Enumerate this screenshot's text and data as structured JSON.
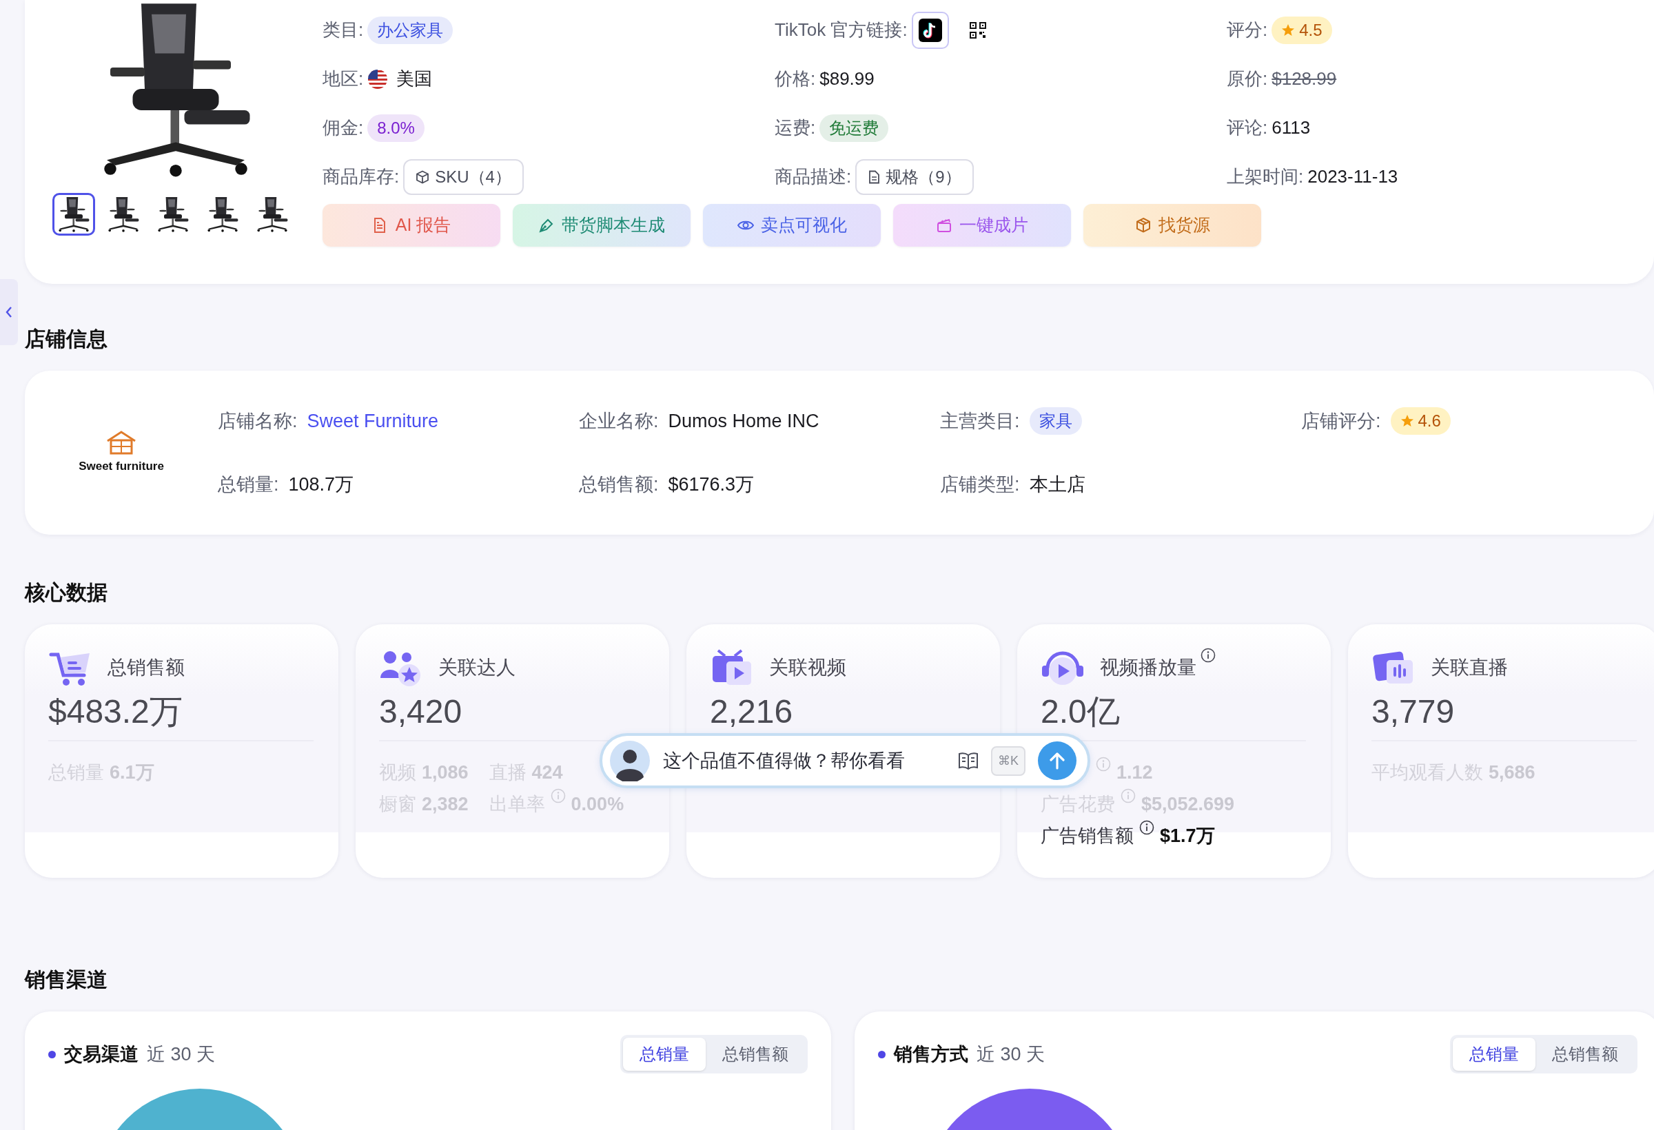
{
  "product": {
    "thumbnails": [
      {
        "selected": true
      },
      {
        "selected": false
      },
      {
        "selected": false
      },
      {
        "selected": false
      },
      {
        "selected": false
      }
    ],
    "fields": [
      {
        "kind": "tag",
        "label": "类目:",
        "value": "办公家具",
        "color": "#3b4fe0"
      },
      {
        "kind": "links",
        "label": "TikTok 官方链接:"
      },
      {
        "kind": "rating",
        "label": "评分:",
        "value": "4.5"
      },
      {
        "kind": "flag",
        "label": "地区:",
        "value": "美国"
      },
      {
        "kind": "plain",
        "label": "价格:",
        "value": "$89.99"
      },
      {
        "kind": "strike",
        "label": "原价:",
        "value": "$128.99"
      },
      {
        "kind": "tag",
        "label": "佣金:",
        "value": "8.0%",
        "color": "#7a1fd0"
      },
      {
        "kind": "tag",
        "label": "运费:",
        "value": "免运费",
        "color": "#1f7a37"
      },
      {
        "kind": "plain",
        "label": "评论:",
        "value": "6113"
      },
      {
        "kind": "sku",
        "label": "商品库存:",
        "value": "SKU（4）"
      },
      {
        "kind": "spec",
        "label": "商品描述:",
        "value": "规格（9）"
      },
      {
        "kind": "plain",
        "label": "上架时间:",
        "value": "2023-11-13"
      }
    ],
    "actions": [
      {
        "kind": "report",
        "label": "AI 报告"
      },
      {
        "kind": "script",
        "label": "带货脚本生成"
      },
      {
        "kind": "visual",
        "label": "卖点可视化"
      },
      {
        "kind": "video",
        "label": "一键成片"
      },
      {
        "kind": "source",
        "label": "找货源"
      }
    ]
  },
  "store": {
    "title": "店铺信息",
    "logo_text": "Sweet furniture",
    "fields": [
      {
        "kind": "link",
        "label": "店铺名称:",
        "value": "Sweet Furniture"
      },
      {
        "kind": "plain",
        "label": "企业名称:",
        "value": "Dumos Home INC"
      },
      {
        "kind": "tag",
        "label": "主营类目:",
        "value": "家具",
        "color": "#3b4fe0"
      },
      {
        "kind": "rating",
        "label": "店铺评分:",
        "value": "4.6"
      },
      {
        "kind": "plain",
        "label": "总销量:",
        "value": "108.7万"
      },
      {
        "kind": "plain",
        "label": "总销售额:",
        "value": "$6176.3万"
      },
      {
        "kind": "plain",
        "label": "店铺类型:",
        "value": "本土店"
      }
    ]
  },
  "core": {
    "title": "核心数据",
    "cards": [
      {
        "kind": "cart",
        "title": "总销售额",
        "info": false,
        "value": "$483.2万",
        "stats": [
          [
            {
              "label": "总销量",
              "value": "6.1万",
              "info": false,
              "muted": true
            }
          ]
        ]
      },
      {
        "kind": "people",
        "title": "关联达人",
        "info": false,
        "value": "3,420",
        "stats": [
          [
            {
              "label": "视频",
              "value": "1,086",
              "info": false,
              "muted": true
            },
            {
              "label": "直播",
              "value": "424",
              "info": false,
              "muted": true
            }
          ],
          [
            {
              "label": "橱窗",
              "value": "2,382",
              "info": false,
              "muted": true
            },
            {
              "label": "出单率",
              "value": "0.00%",
              "info": true,
              "muted": true
            }
          ]
        ]
      },
      {
        "kind": "video",
        "title": "关联视频",
        "info": false,
        "value": "2,216"
      },
      {
        "kind": "play",
        "title": "视频播放量",
        "info": true,
        "value": "2.0亿",
        "stats": [
          [
            {
              "value": "1.12",
              "info": true,
              "muted": true
            }
          ],
          [
            {
              "label": "广告花费",
              "value": "$5,052.699",
              "info": true,
              "muted": true
            }
          ],
          [
            {
              "label": "广告销售额",
              "value": "$1.7万",
              "info": true,
              "muted": false
            }
          ]
        ]
      },
      {
        "kind": "live",
        "title": "关联直播",
        "info": false,
        "value": "3,779",
        "stats": [
          [
            {
              "label": "平均观看人数",
              "value": "5,686",
              "info": false,
              "muted": true
            }
          ]
        ]
      }
    ]
  },
  "assistant": {
    "prompt": "这个品值不值得做？帮你看看",
    "shortcut": "⌘K"
  },
  "channels": {
    "title": "销售渠道",
    "cards": [
      {
        "title": "交易渠道",
        "period": "近 30 天",
        "options": [
          {
            "label": "总销量",
            "selected": true
          },
          {
            "label": "总销售额",
            "selected": false
          }
        ]
      },
      {
        "title": "销售方式",
        "period": "近 30 天",
        "options": [
          {
            "label": "总销量",
            "selected": true
          },
          {
            "label": "总销售额",
            "selected": false
          }
        ]
      }
    ]
  }
}
